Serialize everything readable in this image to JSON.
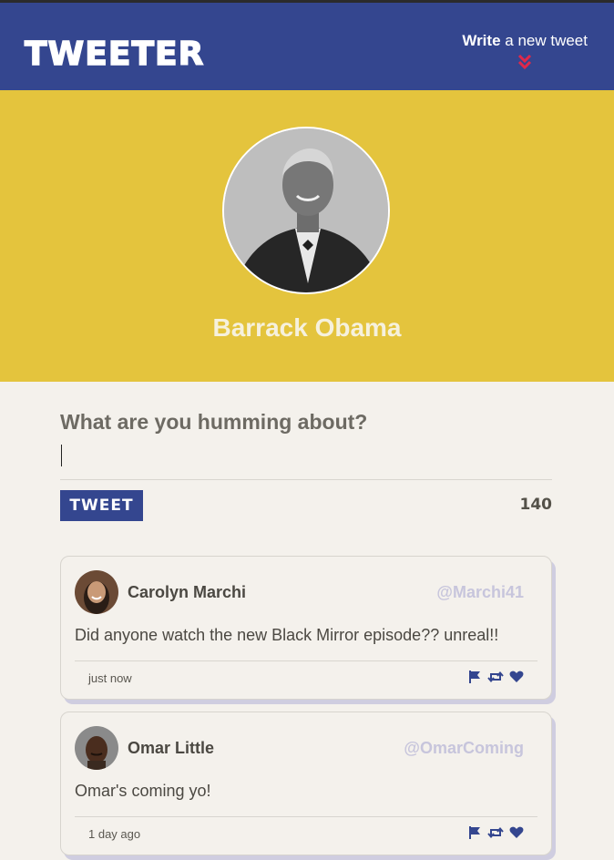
{
  "navbar": {
    "brand": "TWEETER",
    "compose_bold": "Write",
    "compose_rest": "a new tweet"
  },
  "profile": {
    "name": "Barrack Obama"
  },
  "compose": {
    "label": "What are you humming about?",
    "input_value": "",
    "button_label": "TWEET",
    "counter": "140"
  },
  "tweets": [
    {
      "name": "Carolyn Marchi",
      "handle": "@Marchi41",
      "body": "Did anyone watch the new Black Mirror episode?? unreal!!",
      "time": "just now"
    },
    {
      "name": "Omar Little",
      "handle": "@OmarComing",
      "body": "Omar's coming yo!",
      "time": "1 day ago"
    }
  ],
  "colors": {
    "navbar": "#34468f",
    "profile_bg": "#e4c43d",
    "page_bg": "#f4f1ec",
    "accent_red": "#e0284a",
    "handle": "#c7c5dc"
  },
  "icons": [
    "chevron-double-down-icon",
    "flag-icon",
    "retweet-icon",
    "heart-icon"
  ]
}
